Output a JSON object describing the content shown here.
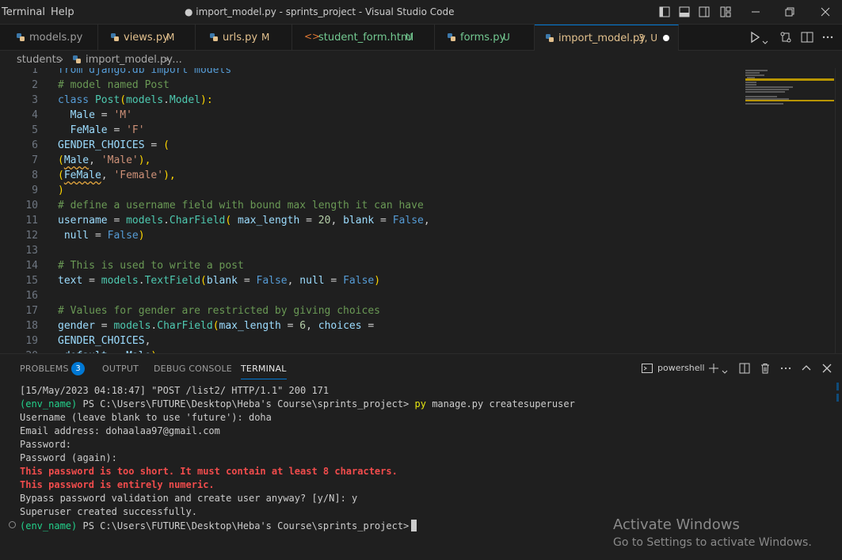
{
  "menu": [
    "Terminal",
    "Help"
  ],
  "window_title": "● import_model.py - sprints_project - Visual Studio Code",
  "tabs": [
    {
      "label": "models.py",
      "status": ""
    },
    {
      "label": "views.py",
      "status": "M"
    },
    {
      "label": "urls.py",
      "status": "M"
    },
    {
      "label": "student_form.html",
      "status": "U"
    },
    {
      "label": "forms.py",
      "status": "U"
    },
    {
      "label": "import_model.py",
      "status": "3, U"
    }
  ],
  "breadcrumb": {
    "folder": "students",
    "sep": "›",
    "file": "import_model.py",
    "rest": "› ..."
  },
  "editor": {
    "lines": [
      {
        "n": "1",
        "segs": [
          {
            "t": "from django.db import models",
            "c": "kw"
          }
        ]
      },
      {
        "n": "2",
        "segs": [
          {
            "t": "# model named Post",
            "c": "cm"
          }
        ]
      },
      {
        "n": "3",
        "segs": [
          {
            "t": "class ",
            "c": "kw"
          },
          {
            "t": "Post",
            "c": "cls"
          },
          {
            "t": "(",
            "c": "br"
          },
          {
            "t": "models",
            "c": "cls"
          },
          {
            "t": ".",
            "c": ""
          },
          {
            "t": "Model",
            "c": "cls"
          },
          {
            "t": "):",
            "c": "br"
          }
        ]
      },
      {
        "n": "4",
        "segs": [
          {
            "t": "  Male",
            "c": "var"
          },
          {
            "t": " = ",
            "c": ""
          },
          {
            "t": "'M'",
            "c": "str"
          }
        ]
      },
      {
        "n": "5",
        "segs": [
          {
            "t": "  FeMale",
            "c": "var"
          },
          {
            "t": " = ",
            "c": ""
          },
          {
            "t": "'F'",
            "c": "str"
          }
        ]
      },
      {
        "n": "6",
        "segs": [
          {
            "t": "GENDER_CHOICES",
            "c": "var"
          },
          {
            "t": " = ",
            "c": ""
          },
          {
            "t": "(",
            "c": "br"
          }
        ]
      },
      {
        "n": "7",
        "segs": [
          {
            "t": "(",
            "c": "br"
          },
          {
            "t": "Male",
            "c": "var wavy"
          },
          {
            "t": ", ",
            "c": ""
          },
          {
            "t": "'Male'",
            "c": "str"
          },
          {
            "t": "),",
            "c": "br"
          }
        ]
      },
      {
        "n": "8",
        "segs": [
          {
            "t": "(",
            "c": "br"
          },
          {
            "t": "FeMale",
            "c": "var wavy"
          },
          {
            "t": ", ",
            "c": ""
          },
          {
            "t": "'Female'",
            "c": "str"
          },
          {
            "t": "),",
            "c": "br"
          }
        ]
      },
      {
        "n": "9",
        "segs": [
          {
            "t": ")",
            "c": "br"
          }
        ]
      },
      {
        "n": "10",
        "segs": [
          {
            "t": "# define a username field with bound max length it can have",
            "c": "cm"
          }
        ]
      },
      {
        "n": "11",
        "segs": [
          {
            "t": "username",
            "c": "var"
          },
          {
            "t": " = ",
            "c": ""
          },
          {
            "t": "models",
            "c": "cls"
          },
          {
            "t": ".",
            "c": ""
          },
          {
            "t": "CharField",
            "c": "cls"
          },
          {
            "t": "( ",
            "c": "br"
          },
          {
            "t": "max_length",
            "c": "var"
          },
          {
            "t": " = ",
            "c": ""
          },
          {
            "t": "20",
            "c": "nm"
          },
          {
            "t": ", ",
            "c": ""
          },
          {
            "t": "blank",
            "c": "var"
          },
          {
            "t": " = ",
            "c": ""
          },
          {
            "t": "False",
            "c": "kw"
          },
          {
            "t": ",",
            "c": ""
          }
        ]
      },
      {
        "n": "12",
        "segs": [
          {
            "t": " null",
            "c": "var"
          },
          {
            "t": " = ",
            "c": ""
          },
          {
            "t": "False",
            "c": "kw"
          },
          {
            "t": ")",
            "c": "br"
          }
        ]
      },
      {
        "n": "13",
        "segs": []
      },
      {
        "n": "14",
        "segs": [
          {
            "t": "# This is used to write a post",
            "c": "cm"
          }
        ]
      },
      {
        "n": "15",
        "segs": [
          {
            "t": "text",
            "c": "var"
          },
          {
            "t": " = ",
            "c": ""
          },
          {
            "t": "models",
            "c": "cls"
          },
          {
            "t": ".",
            "c": ""
          },
          {
            "t": "TextField",
            "c": "cls"
          },
          {
            "t": "(",
            "c": "br"
          },
          {
            "t": "blank",
            "c": "var"
          },
          {
            "t": " = ",
            "c": ""
          },
          {
            "t": "False",
            "c": "kw"
          },
          {
            "t": ", ",
            "c": ""
          },
          {
            "t": "null",
            "c": "var"
          },
          {
            "t": " = ",
            "c": ""
          },
          {
            "t": "False",
            "c": "kw"
          },
          {
            "t": ")",
            "c": "br"
          }
        ]
      },
      {
        "n": "16",
        "segs": []
      },
      {
        "n": "17",
        "segs": [
          {
            "t": "# Values for gender are restricted by giving choices",
            "c": "cm"
          }
        ]
      },
      {
        "n": "18",
        "segs": [
          {
            "t": "gender",
            "c": "var"
          },
          {
            "t": " = ",
            "c": ""
          },
          {
            "t": "models",
            "c": "cls"
          },
          {
            "t": ".",
            "c": ""
          },
          {
            "t": "CharField",
            "c": "cls"
          },
          {
            "t": "(",
            "c": "br"
          },
          {
            "t": "max_length",
            "c": "var"
          },
          {
            "t": " = ",
            "c": ""
          },
          {
            "t": "6",
            "c": "nm"
          },
          {
            "t": ", ",
            "c": ""
          },
          {
            "t": "choices",
            "c": "var"
          },
          {
            "t": " =",
            "c": ""
          }
        ]
      },
      {
        "n": "19",
        "segs": [
          {
            "t": "GENDER_CHOICES",
            "c": "var"
          },
          {
            "t": ",",
            "c": ""
          }
        ]
      },
      {
        "n": "20",
        "segs": [
          {
            "t": " default",
            "c": "var"
          },
          {
            "t": " = ",
            "c": ""
          },
          {
            "t": "Male",
            "c": "var"
          },
          {
            "t": ")",
            "c": "br"
          }
        ]
      }
    ]
  },
  "panel": {
    "tabs": [
      "PROBLEMS",
      "OUTPUT",
      "DEBUG CONSOLE",
      "TERMINAL"
    ],
    "problems_count": "3",
    "shell": "powershell",
    "terminal": {
      "l1": "[15/May/2023 04:18:47] \"POST /list2/ HTTP/1.1\" 200 171",
      "env": "(env_name)",
      "prompt": " PS C:\\Users\\FUTURE\\Desktop\\Heba's Course\\sprints_project> ",
      "cmd": "py",
      "cmd_rest": " manage.py createsuperuser",
      "l3": "Username (leave blank to use 'future'): doha",
      "l4": "Email address: dohaalaa97@gmail.com",
      "l5": "Password:",
      "l6": "Password (again):",
      "e1": "This password is too short. It must contain at least 8 characters.",
      "e2": "This password is entirely numeric.",
      "l9": "Bypass password validation and create user anyway? [y/N]: y",
      "l10": "Superuser created successfully.",
      "prompt2": " PS C:\\Users\\FUTURE\\Desktop\\Heba's Course\\sprints_project>"
    }
  },
  "watermark": {
    "title": "Activate Windows",
    "subtitle": "Go to Settings to activate Windows."
  },
  "colors": {
    "accent": "#0078d4",
    "modified": "#e2c08d",
    "error": "#f14c4c",
    "env": "#23d18b"
  }
}
